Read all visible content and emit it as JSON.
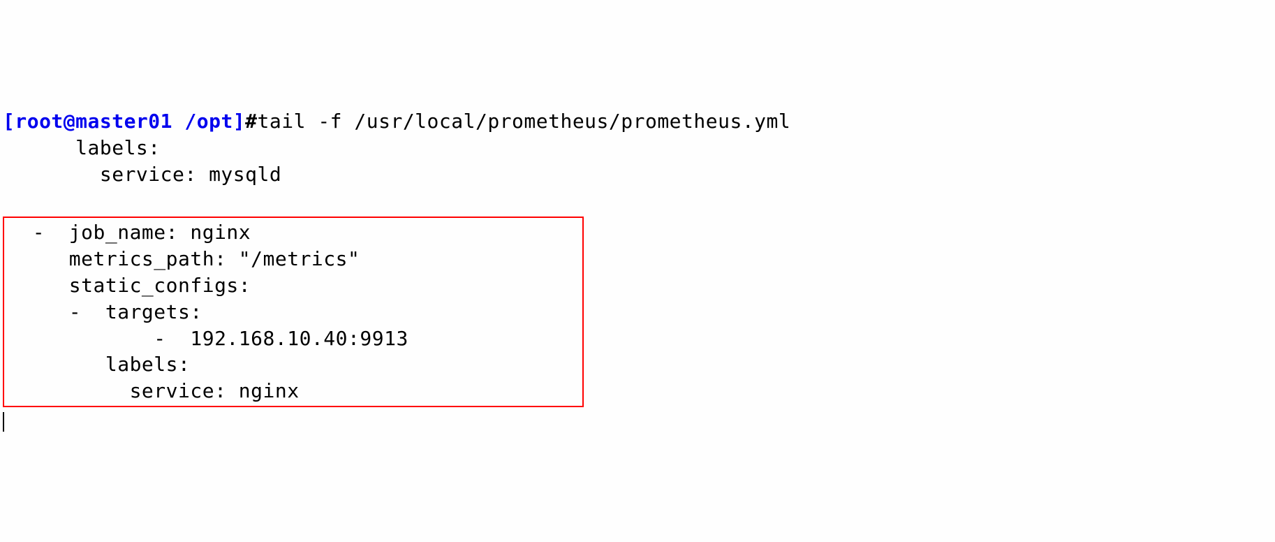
{
  "prompt": {
    "open_bracket": "[",
    "user_host": "root@master01",
    "path": " /opt",
    "close_bracket": "]",
    "symbol": "#"
  },
  "command": "tail -f /usr/local/prometheus/prometheus.yml",
  "output_lines": {
    "line1": "      labels:",
    "line2": "        service: mysqld",
    "line3": "",
    "box_line1": "  -  job_name: nginx",
    "box_line2": "     metrics_path: \"/metrics\"",
    "box_line3": "     static_configs:",
    "box_line4": "     -  targets:",
    "box_line5": "            -  192.168.10.40:9913",
    "box_line6": "        labels:",
    "box_line7": "          service: nginx"
  }
}
